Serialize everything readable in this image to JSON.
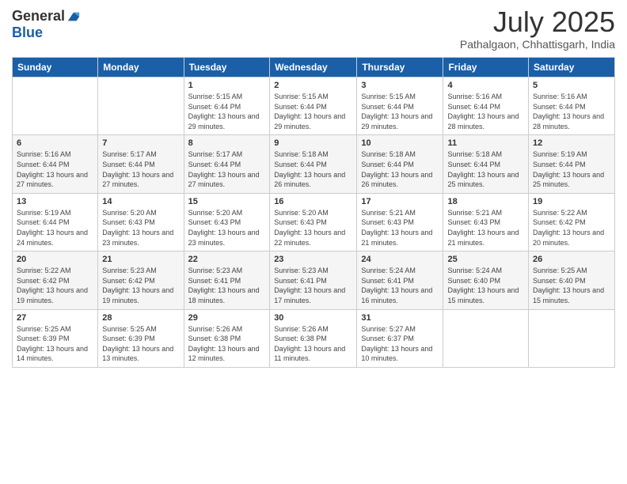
{
  "logo": {
    "general": "General",
    "blue": "Blue"
  },
  "header": {
    "month": "July 2025",
    "location": "Pathalgaon, Chhattisgarh, India"
  },
  "weekdays": [
    "Sunday",
    "Monday",
    "Tuesday",
    "Wednesday",
    "Thursday",
    "Friday",
    "Saturday"
  ],
  "weeks": [
    [
      {
        "day": "",
        "info": ""
      },
      {
        "day": "",
        "info": ""
      },
      {
        "day": "1",
        "info": "Sunrise: 5:15 AM\nSunset: 6:44 PM\nDaylight: 13 hours and 29 minutes."
      },
      {
        "day": "2",
        "info": "Sunrise: 5:15 AM\nSunset: 6:44 PM\nDaylight: 13 hours and 29 minutes."
      },
      {
        "day": "3",
        "info": "Sunrise: 5:15 AM\nSunset: 6:44 PM\nDaylight: 13 hours and 29 minutes."
      },
      {
        "day": "4",
        "info": "Sunrise: 5:16 AM\nSunset: 6:44 PM\nDaylight: 13 hours and 28 minutes."
      },
      {
        "day": "5",
        "info": "Sunrise: 5:16 AM\nSunset: 6:44 PM\nDaylight: 13 hours and 28 minutes."
      }
    ],
    [
      {
        "day": "6",
        "info": "Sunrise: 5:16 AM\nSunset: 6:44 PM\nDaylight: 13 hours and 27 minutes."
      },
      {
        "day": "7",
        "info": "Sunrise: 5:17 AM\nSunset: 6:44 PM\nDaylight: 13 hours and 27 minutes."
      },
      {
        "day": "8",
        "info": "Sunrise: 5:17 AM\nSunset: 6:44 PM\nDaylight: 13 hours and 27 minutes."
      },
      {
        "day": "9",
        "info": "Sunrise: 5:18 AM\nSunset: 6:44 PM\nDaylight: 13 hours and 26 minutes."
      },
      {
        "day": "10",
        "info": "Sunrise: 5:18 AM\nSunset: 6:44 PM\nDaylight: 13 hours and 26 minutes."
      },
      {
        "day": "11",
        "info": "Sunrise: 5:18 AM\nSunset: 6:44 PM\nDaylight: 13 hours and 25 minutes."
      },
      {
        "day": "12",
        "info": "Sunrise: 5:19 AM\nSunset: 6:44 PM\nDaylight: 13 hours and 25 minutes."
      }
    ],
    [
      {
        "day": "13",
        "info": "Sunrise: 5:19 AM\nSunset: 6:44 PM\nDaylight: 13 hours and 24 minutes."
      },
      {
        "day": "14",
        "info": "Sunrise: 5:20 AM\nSunset: 6:43 PM\nDaylight: 13 hours and 23 minutes."
      },
      {
        "day": "15",
        "info": "Sunrise: 5:20 AM\nSunset: 6:43 PM\nDaylight: 13 hours and 23 minutes."
      },
      {
        "day": "16",
        "info": "Sunrise: 5:20 AM\nSunset: 6:43 PM\nDaylight: 13 hours and 22 minutes."
      },
      {
        "day": "17",
        "info": "Sunrise: 5:21 AM\nSunset: 6:43 PM\nDaylight: 13 hours and 21 minutes."
      },
      {
        "day": "18",
        "info": "Sunrise: 5:21 AM\nSunset: 6:43 PM\nDaylight: 13 hours and 21 minutes."
      },
      {
        "day": "19",
        "info": "Sunrise: 5:22 AM\nSunset: 6:42 PM\nDaylight: 13 hours and 20 minutes."
      }
    ],
    [
      {
        "day": "20",
        "info": "Sunrise: 5:22 AM\nSunset: 6:42 PM\nDaylight: 13 hours and 19 minutes."
      },
      {
        "day": "21",
        "info": "Sunrise: 5:23 AM\nSunset: 6:42 PM\nDaylight: 13 hours and 19 minutes."
      },
      {
        "day": "22",
        "info": "Sunrise: 5:23 AM\nSunset: 6:41 PM\nDaylight: 13 hours and 18 minutes."
      },
      {
        "day": "23",
        "info": "Sunrise: 5:23 AM\nSunset: 6:41 PM\nDaylight: 13 hours and 17 minutes."
      },
      {
        "day": "24",
        "info": "Sunrise: 5:24 AM\nSunset: 6:41 PM\nDaylight: 13 hours and 16 minutes."
      },
      {
        "day": "25",
        "info": "Sunrise: 5:24 AM\nSunset: 6:40 PM\nDaylight: 13 hours and 15 minutes."
      },
      {
        "day": "26",
        "info": "Sunrise: 5:25 AM\nSunset: 6:40 PM\nDaylight: 13 hours and 15 minutes."
      }
    ],
    [
      {
        "day": "27",
        "info": "Sunrise: 5:25 AM\nSunset: 6:39 PM\nDaylight: 13 hours and 14 minutes."
      },
      {
        "day": "28",
        "info": "Sunrise: 5:25 AM\nSunset: 6:39 PM\nDaylight: 13 hours and 13 minutes."
      },
      {
        "day": "29",
        "info": "Sunrise: 5:26 AM\nSunset: 6:38 PM\nDaylight: 13 hours and 12 minutes."
      },
      {
        "day": "30",
        "info": "Sunrise: 5:26 AM\nSunset: 6:38 PM\nDaylight: 13 hours and 11 minutes."
      },
      {
        "day": "31",
        "info": "Sunrise: 5:27 AM\nSunset: 6:37 PM\nDaylight: 13 hours and 10 minutes."
      },
      {
        "day": "",
        "info": ""
      },
      {
        "day": "",
        "info": ""
      }
    ]
  ]
}
